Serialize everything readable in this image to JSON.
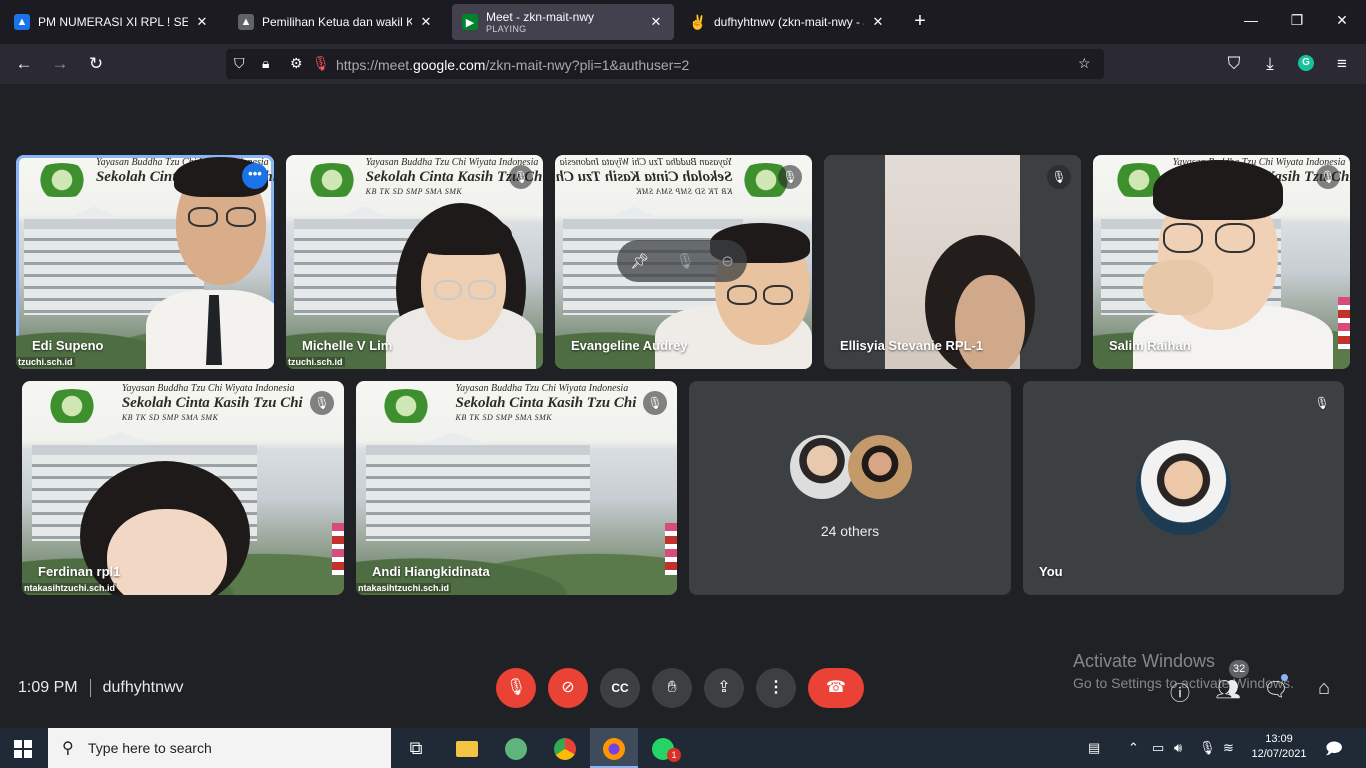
{
  "browser": {
    "tabs": [
      {
        "title": "PM NUMERASI XI RPL ! SENIN",
        "close": "✕",
        "icon": "classroom-icon",
        "color": "#1a73e8"
      },
      {
        "title": "Pemilihan Ketua dan wakil Ketua",
        "close": "✕",
        "icon": "classroom-icon",
        "color": "#5f6368"
      },
      {
        "title": "Meet - zkn-mait-nwy",
        "subtitle": "PLAYING",
        "close": "✕",
        "icon": "meet-icon",
        "active": true
      },
      {
        "title": "dufhyhtnwv (zkn-mait-nwy - Ju",
        "close": "✕",
        "icon": "hand-emoji-icon"
      }
    ],
    "new_tab": "+",
    "url_prefix": "https://meet.",
    "url_host": "google.com",
    "url_path": "/zkn-mait-nwy?pli=1&authuser=2",
    "extension": "G"
  },
  "participants": [
    {
      "name": "Edi Supeno",
      "speaking": true
    },
    {
      "name": "Michelle V Lim"
    },
    {
      "name": "Evangeline Audrey"
    },
    {
      "name": "Ellisyia Stevanie RPL-1"
    },
    {
      "name": "Salim Raihan"
    },
    {
      "name": "Ferdinan rpl1"
    },
    {
      "name": "Andi Hiangkidinata"
    }
  ],
  "background": {
    "line1": "Yayasan Buddha Tzu Chi Wiyata Indonesia",
    "line2": "Sekolah Cinta Kasih Tzu Chi",
    "line3": "KB TK SD SMP SMA SMK",
    "url": "ntakasihtzuchi.sch.id"
  },
  "others_label": "24 others",
  "you_label": "You",
  "meeting": {
    "time": "1:09 PM",
    "code": "dufhyhtnwv",
    "people_count": "32"
  },
  "watermark": {
    "line1": "Activate Windows",
    "line2": "Go to Settings to activate Windows."
  },
  "taskbar": {
    "search_placeholder": "Type here to search",
    "time": "13:09",
    "date": "12/07/2021",
    "whatsapp_badge": "1"
  },
  "colors": {
    "accent_blue": "#1a73e8",
    "end_call_red": "#ea4335",
    "meet_bg": "#202124"
  }
}
